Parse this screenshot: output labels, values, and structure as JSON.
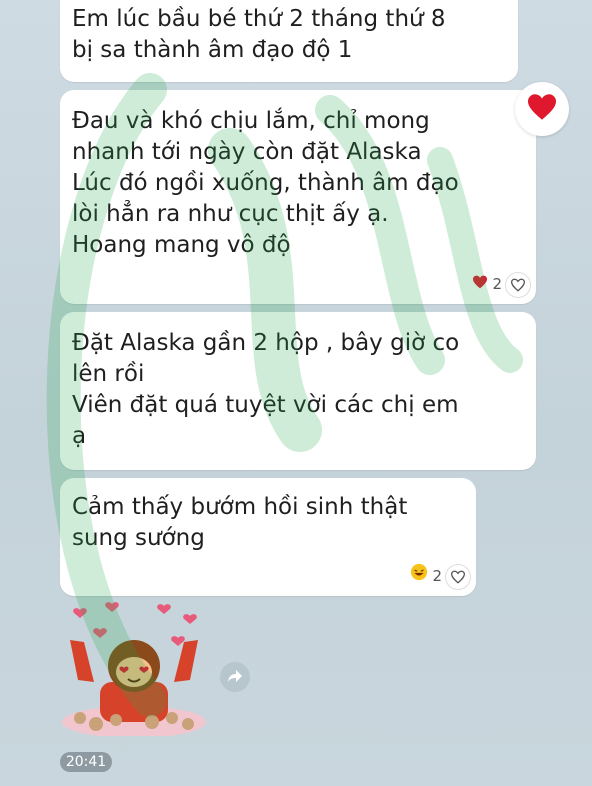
{
  "messages": [
    {
      "lines": [
        "Em lúc bầu bé thứ 2 tháng thứ 8",
        "bị sa thành âm đạo độ 1"
      ]
    },
    {
      "lines": [
        "Đau và khó chịu lắm, chỉ mong",
        "nhanh tới ngày còn đặt Alaska",
        "Lúc đó ngồi xuống, thành âm đạo",
        "lòi hẳn ra như cục thịt ấy ạ.",
        "Hoang mang vô độ"
      ],
      "reaction_count": "2"
    },
    {
      "lines": [
        "Đặt Alaska gần 2 hộp , bây giờ co",
        "lên rồi",
        "Viên đặt quá tuyệt vời các chị em",
        "ạ"
      ]
    },
    {
      "lines": [
        "Cảm thấy bướm hồi sinh thật",
        "sung sướng"
      ],
      "reaction_count": "2"
    }
  ],
  "timestamp": "20:41",
  "colors": {
    "heart": "#e0182d",
    "watermark": "#1fa84a",
    "background": "#c9d6dd"
  },
  "icons": {
    "reaction_heart": "heart-icon",
    "reaction_laugh": "laughing-face-icon",
    "forward": "forward-arrow-icon"
  }
}
